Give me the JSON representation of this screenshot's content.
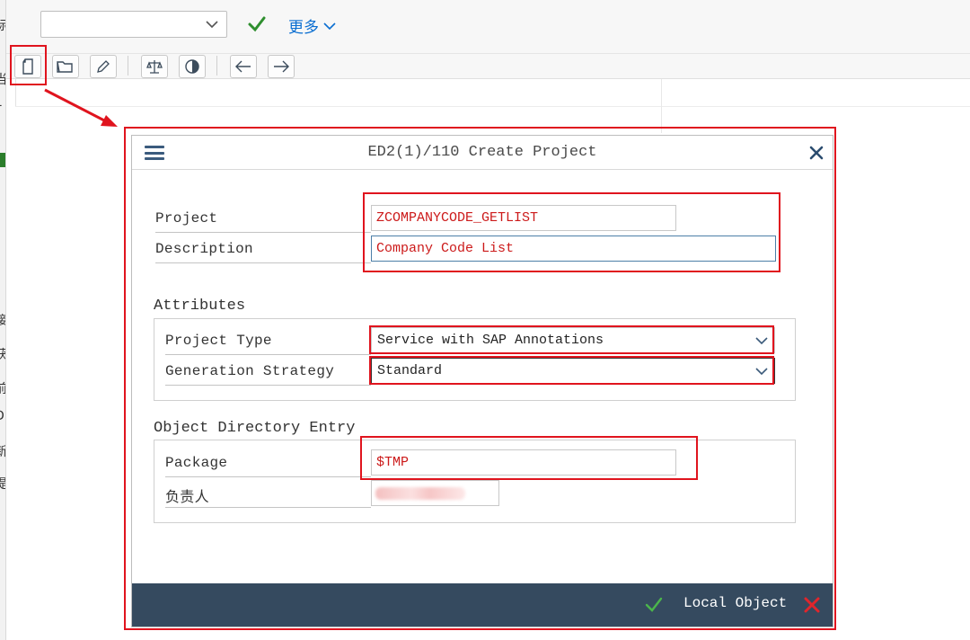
{
  "toolbar": {
    "select_value": "",
    "more_label": "更多"
  },
  "dialog": {
    "title": "ED2(1)/110 Create Project",
    "project_label": "Project",
    "project_value": "ZCOMPANYCODE_GETLIST",
    "description_label": "Description",
    "description_value": "Company Code List",
    "attributes_title": "Attributes",
    "project_type_label": "Project Type",
    "project_type_value": "Service with SAP Annotations",
    "generation_strategy_label": "Generation Strategy",
    "generation_strategy_value": "Standard",
    "object_directory_title": "Object Directory Entry",
    "package_label": "Package",
    "package_value": "$TMP",
    "responsible_label": "负责人",
    "footer_action_label": "Local Object"
  },
  "colors": {
    "annotation_red": "#e0141e",
    "footer_bg": "#354a5f",
    "input_text_red": "#cc1a1a",
    "accent_blue": "#0a6ed1"
  },
  "icons": [
    "chevron-down-icon",
    "checkmark-icon",
    "new-document-icon",
    "open-folder-icon",
    "edit-icon",
    "scales-icon",
    "globe-icon",
    "arrow-left-icon",
    "arrow-right-icon",
    "menu-icon",
    "close-icon",
    "cancel-icon"
  ]
}
